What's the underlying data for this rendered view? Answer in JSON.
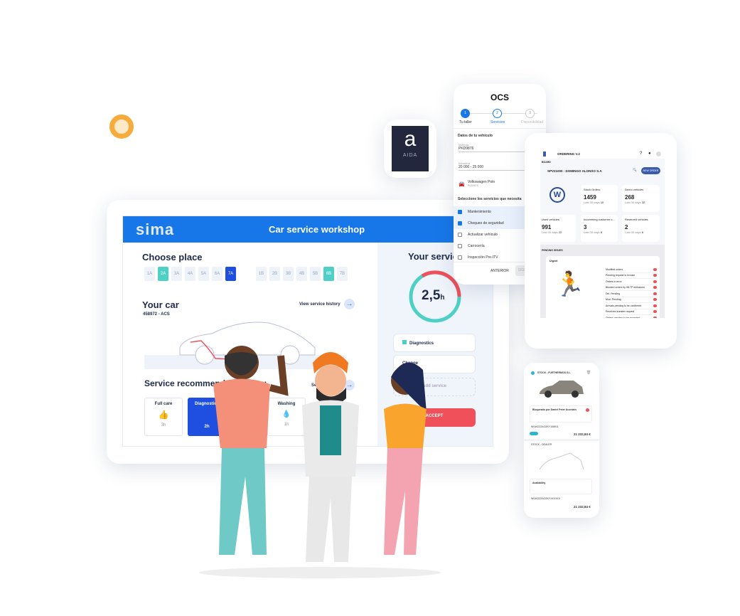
{
  "main_app": {
    "logo": "sima",
    "title": "Car service workshop",
    "choose_place": "Choose place",
    "slots_a": [
      "1A",
      "2A",
      "3A",
      "4A",
      "5A",
      "6A",
      "7A"
    ],
    "slots_b": [
      "1B",
      "2B",
      "3B",
      "4B",
      "5B",
      "6B",
      "7B"
    ],
    "your_car": "Your car",
    "car_id": "458972 - ACS",
    "view_history": "View service history",
    "service_recommended": "Service recommended for you",
    "see_all": "See all",
    "cards": [
      {
        "label": "Full care",
        "time": "3h"
      },
      {
        "label": "Diagnostics",
        "time": "2h"
      },
      {
        "label": "Washing",
        "time": "1h"
      }
    ],
    "your_service": "Your service",
    "duration": "2,5",
    "duration_unit": "h",
    "services": [
      "Diagnostics",
      "Change"
    ],
    "add_service": "Add service",
    "accept": "ACCEPT",
    "colors": {
      "brand": "#1877e8",
      "accent": "#4ed0c6",
      "danger": "#f0505a"
    }
  },
  "aida": {
    "letter": "a",
    "label": "AIDA"
  },
  "ocs": {
    "title": "OCS",
    "steps": [
      {
        "n": "1",
        "label": "Tu taller"
      },
      {
        "n": "2",
        "label": "Servicios"
      },
      {
        "n": "3",
        "label": "Disponibilidad"
      }
    ],
    "section_vehicle": "Datos de tu vehículo",
    "plate_label": "Matrícula",
    "plate": "PKD9876",
    "km_label": "Kilómetros",
    "km": "20 000 - 25 000",
    "car_model": "Volkswagen Polo",
    "car_plate": "PKD9876",
    "section_services": "Seleccione los servicios que necesita",
    "services": [
      {
        "label": "Mantenimiento",
        "checked": true
      },
      {
        "label": "Chequeo de seguridad",
        "checked": true
      },
      {
        "label": "Actualizar vehículo",
        "checked": false
      },
      {
        "label": "Carrocería",
        "checked": false
      },
      {
        "label": "Inspección Pre-ITV",
        "checked": false
      }
    ],
    "prev": "ANTERIOR",
    "next": "SIGUIENTE"
  },
  "ordering": {
    "title": "ORDERING V.2",
    "breadcrumb": "BOARD",
    "dealer": "SPV21000 - DOMINGO ALONSO S.A",
    "new_order": "NEW ORDER",
    "stats": [
      {
        "label": "Stock Orders",
        "value": "1459",
        "sub": "Last 30 days",
        "delta": "10"
      },
      {
        "label": "Demo vehicles",
        "value": "268",
        "sub": "Last 30 days",
        "delta": "32"
      },
      {
        "label": "Used vehicles",
        "value": "991",
        "sub": "Last 30 days",
        "delta": "22"
      },
      {
        "label": "Incomming customer o...",
        "value": "3",
        "sub": "Last 30 days",
        "delta": "8"
      },
      {
        "label": "Reserved vehicles",
        "value": "2",
        "sub": "Last 30 days",
        "delta": "6"
      }
    ],
    "issues_title": "PENDING ISSUES",
    "urgent": "Urgent",
    "issues": [
      "Modified orders",
      "Pending request to invoice",
      "Orders in error",
      "Blocked orders by WLTP emissions",
      "Del. Pending",
      "Mod. Pending",
      "Arrivals pending to be confirmed",
      "Received transfer request",
      "Orders pending to be accepted"
    ]
  },
  "stock_phone": {
    "header": "STOCK - FURTHERMOS S.L.",
    "note_title": "Bloqueado por Daniel Peter Acontain",
    "vin1": "WVWZZZAOZKY108911",
    "price1": "21 232,84 €",
    "section2": "STOCK - DEALER",
    "availability": "Availability",
    "vin2": "WVWZZZAOZKYXXXXXX",
    "price2": "21 232,84 €"
  }
}
